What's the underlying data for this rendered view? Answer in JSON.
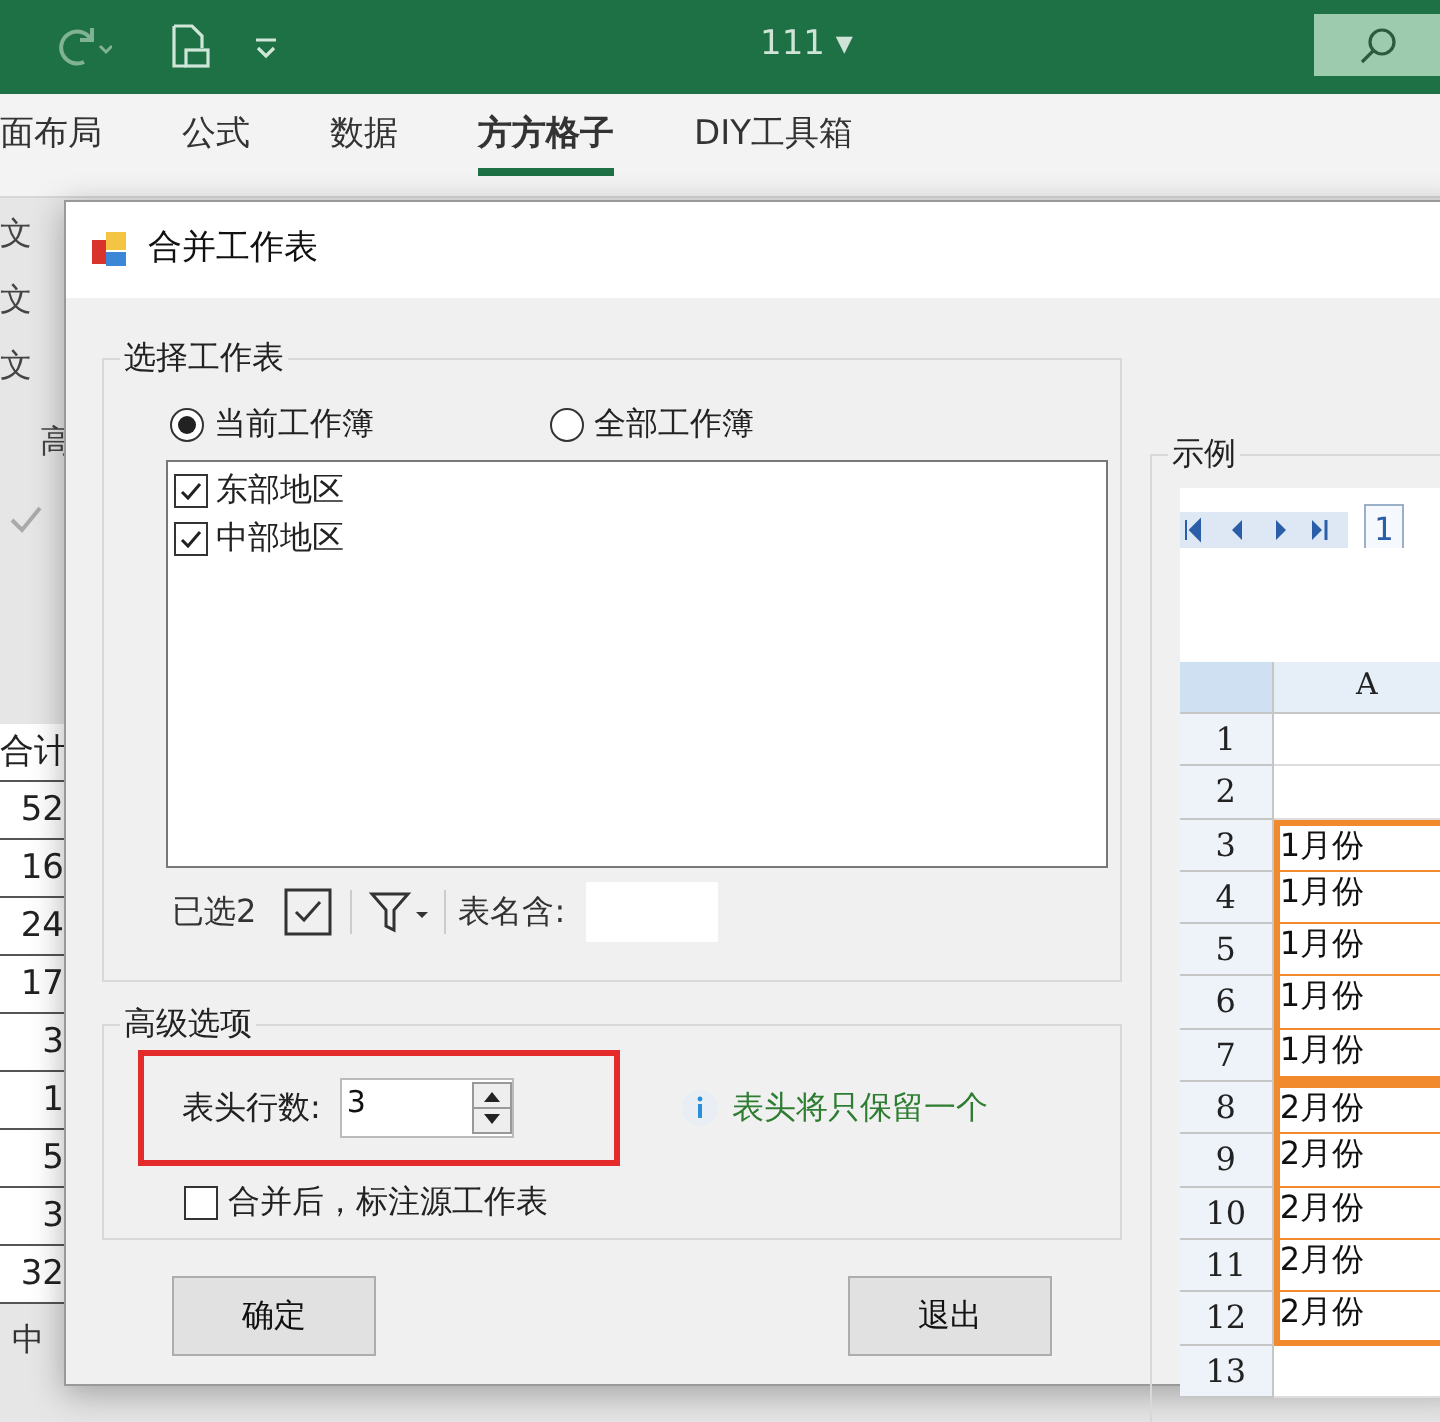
{
  "app": {
    "title": "111 ▾"
  },
  "ribbon_tabs": [
    {
      "label": "面布局",
      "selected": false
    },
    {
      "label": "公式",
      "selected": false
    },
    {
      "label": "数据",
      "selected": false
    },
    {
      "label": "方方格子",
      "selected": true
    },
    {
      "label": "DIY工具箱",
      "selected": false
    }
  ],
  "background_sheet": {
    "ribbon_texts": [
      "文",
      "文",
      "文",
      "高"
    ],
    "cells": [
      "合计",
      "52",
      "16",
      "24",
      "17",
      "3",
      "1",
      "5",
      "3",
      "32"
    ],
    "sheet_tab": "中"
  },
  "dialog": {
    "title": "合并工作表",
    "select_group": {
      "title": "选择工作表",
      "scope": [
        {
          "label": "当前工作簿",
          "selected": true
        },
        {
          "label": "全部工作簿",
          "selected": false
        }
      ],
      "sheets": [
        {
          "label": "东部地区",
          "checked": true
        },
        {
          "label": "中部地区",
          "checked": true
        }
      ],
      "selected_count": "已选2",
      "name_filter_label": "表名含:"
    },
    "advanced_group": {
      "title": "高级选项",
      "header_rows_label": "表头行数:",
      "header_rows_value": "3",
      "hint": "表头将只保留一个",
      "mark_source": {
        "label": "合并后，标注源工作表",
        "checked": false
      }
    },
    "buttons": [
      "确定",
      "退出"
    ],
    "example": {
      "title": "示例",
      "sheet_tab": "1",
      "column": "A",
      "blocks": [
        {
          "boxed": false,
          "rows": [
            {
              "n": "1",
              "value": ""
            },
            {
              "n": "2",
              "value": ""
            }
          ]
        },
        {
          "boxed": true,
          "rows": [
            {
              "n": "3",
              "value": "1月份"
            },
            {
              "n": "4",
              "value": "1月份"
            },
            {
              "n": "5",
              "value": "1月份"
            },
            {
              "n": "6",
              "value": "1月份"
            },
            {
              "n": "7",
              "value": "1月份"
            }
          ]
        },
        {
          "boxed": true,
          "rows": [
            {
              "n": "8",
              "value": "2月份"
            },
            {
              "n": "9",
              "value": "2月份"
            },
            {
              "n": "10",
              "value": "2月份"
            },
            {
              "n": "11",
              "value": "2月份"
            },
            {
              "n": "12",
              "value": "2月份"
            }
          ]
        },
        {
          "boxed": false,
          "rows": [
            {
              "n": "13",
              "value": ""
            }
          ]
        }
      ]
    }
  }
}
